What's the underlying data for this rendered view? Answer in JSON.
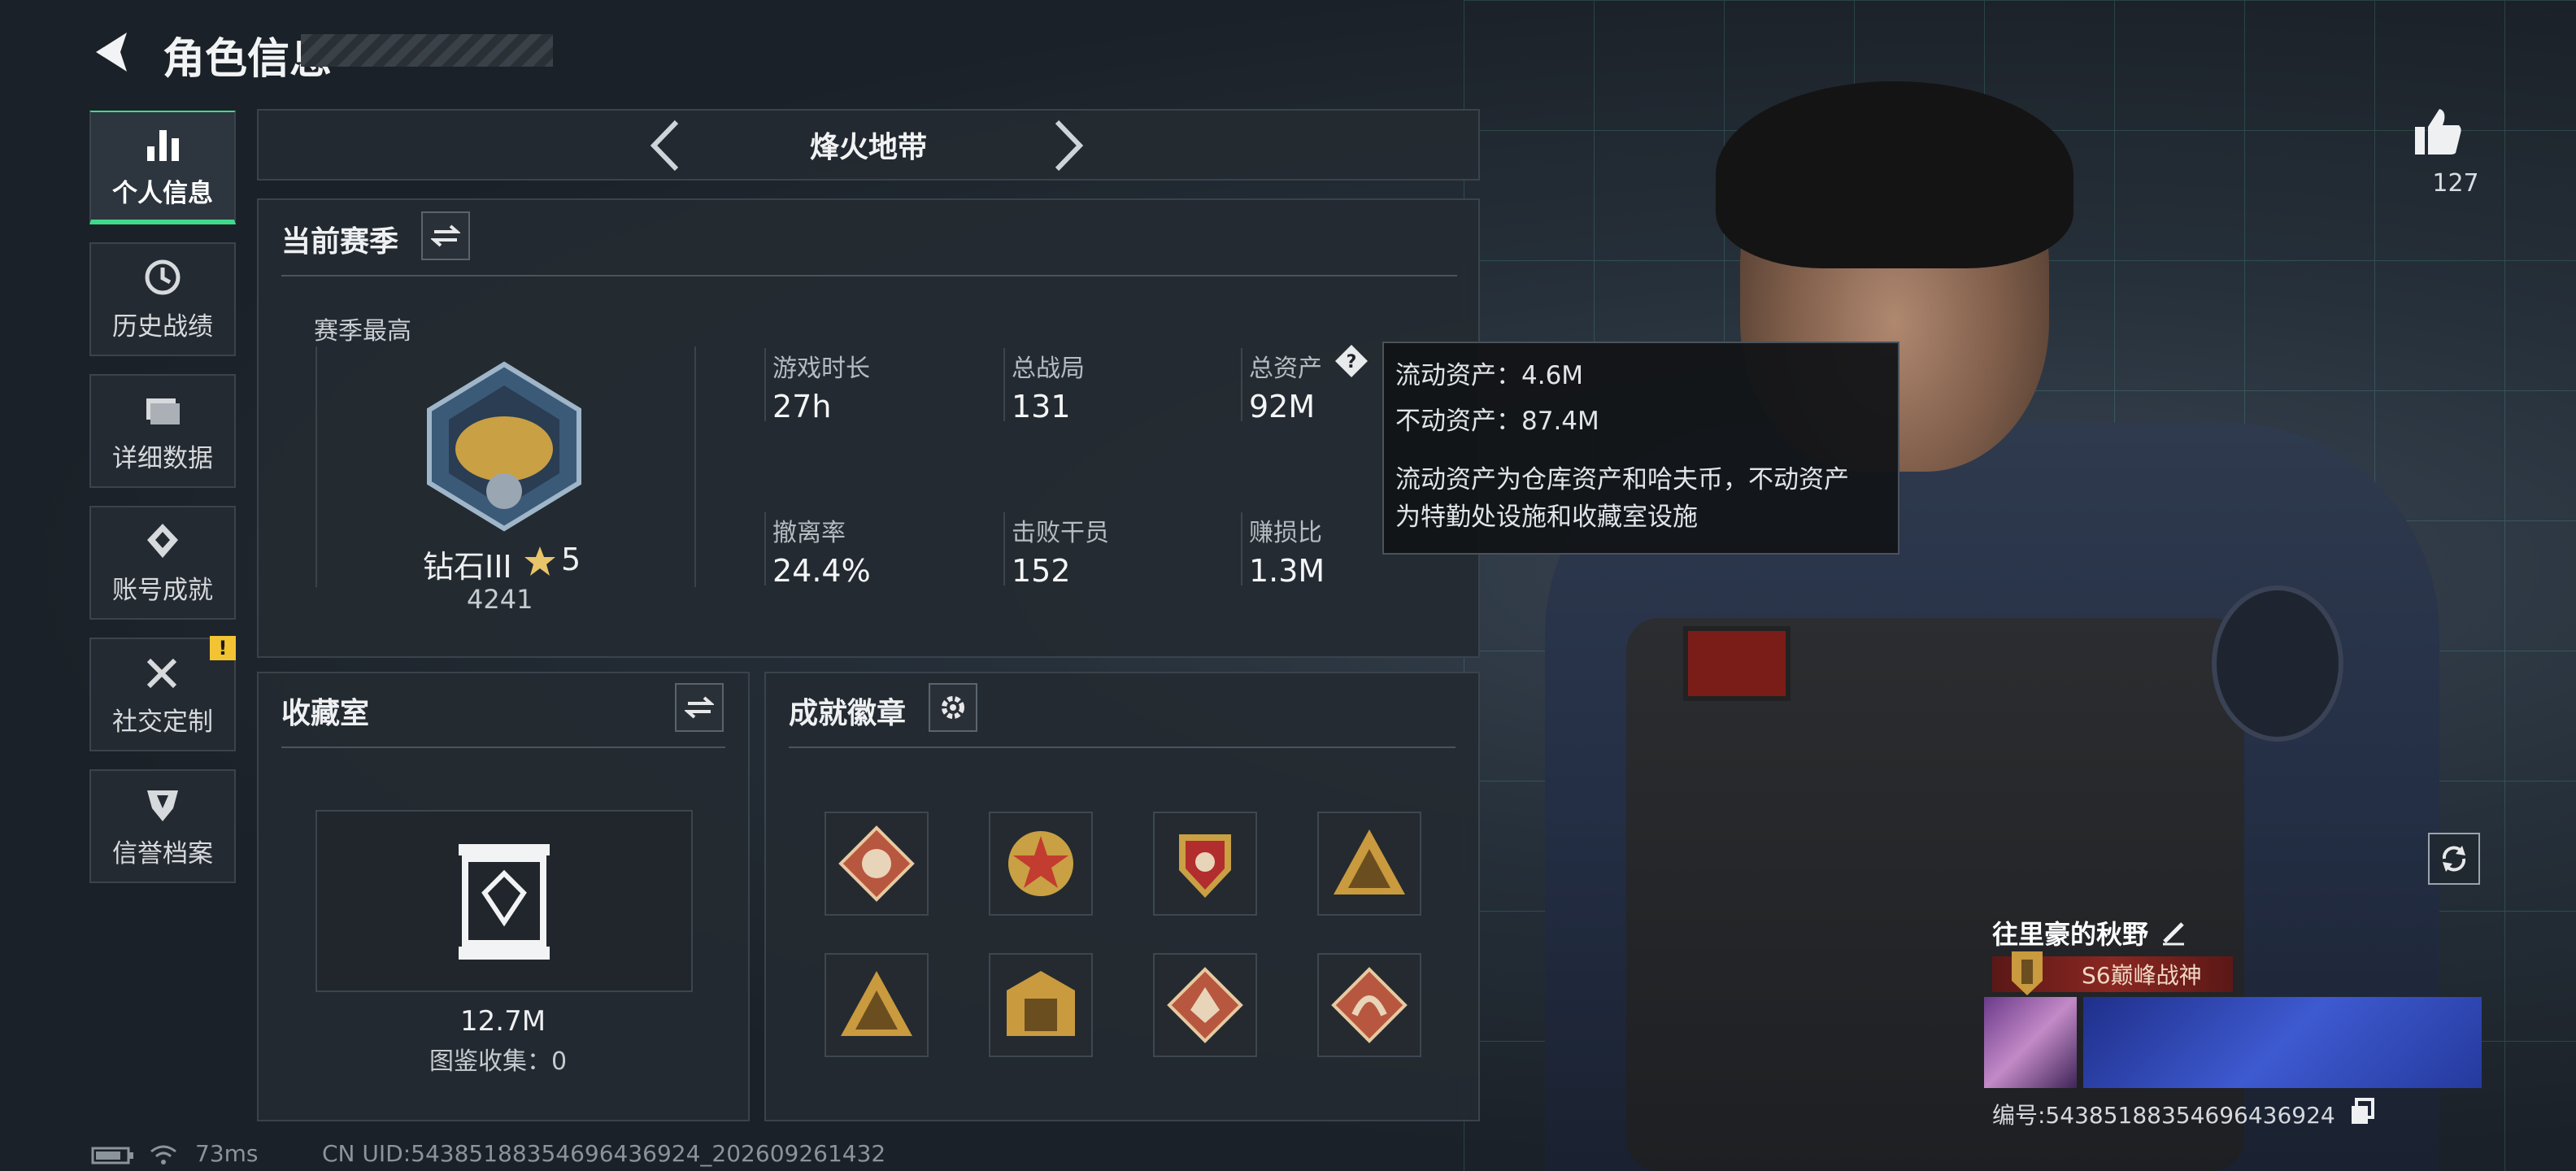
{
  "header": {
    "title": "角色信息"
  },
  "nav": {
    "items": [
      {
        "label": "个人信息",
        "icon": "bar-chart-icon",
        "active": true
      },
      {
        "label": "历史战绩",
        "icon": "history-clock-icon",
        "active": false
      },
      {
        "label": "详细数据",
        "icon": "folder-icon",
        "active": false
      },
      {
        "label": "账号成就",
        "icon": "achievement-badge-icon",
        "active": false
      },
      {
        "label": "社交定制",
        "icon": "tools-icon",
        "active": false
      },
      {
        "label": "信誉档案",
        "icon": "credit-shield-icon",
        "active": false
      }
    ],
    "warning_badge": "!"
  },
  "mode": {
    "name": "烽火地带"
  },
  "season": {
    "title": "当前赛季",
    "best_label": "赛季最高",
    "rank_name": "钻石III",
    "rank_stars": "5",
    "rank_score": "4241",
    "stats": [
      {
        "label": "游戏时长",
        "value": "27h"
      },
      {
        "label": "总战局",
        "value": "131"
      },
      {
        "label": "总资产",
        "value": "92M"
      },
      {
        "label": "撤离率",
        "value": "24.4%"
      },
      {
        "label": "击败干员",
        "value": "152"
      },
      {
        "label": "赚损比",
        "value": "1.3M"
      }
    ]
  },
  "tooltip": {
    "line1": "流动资产：4.6M",
    "line2": "不动资产：87.4M",
    "desc1": "流动资产为仓库资产和哈夫币，不动资产",
    "desc2": "为特勤处设施和收藏室设施"
  },
  "collection": {
    "title": "收藏室",
    "value": "12.7M",
    "catalog": "图鉴收集：0"
  },
  "achievements": {
    "title": "成就徽章",
    "badges": [
      {
        "icon": "beast-head-badge-icon",
        "color": "#b8573f"
      },
      {
        "icon": "star-emblem-badge-icon",
        "color": "#c23c2f"
      },
      {
        "icon": "shield-stars-badge-icon",
        "color": "#b22d2d"
      },
      {
        "icon": "s5-triangle-badge-icon",
        "color": "#c99a3e"
      },
      {
        "icon": "s6-triangle-badge-icon",
        "color": "#c99a3e"
      },
      {
        "icon": "gate-badge-icon",
        "color": "#c99a3e"
      },
      {
        "icon": "wolf-badge-icon",
        "color": "#b8573f"
      },
      {
        "icon": "dragon-badge-icon",
        "color": "#b8573f"
      }
    ]
  },
  "player": {
    "likes": "127",
    "name": "往里豪的秋野",
    "rank_title": "S6巅峰战神",
    "uid_display": "编号:543851883546964369​24"
  },
  "status": {
    "ping": "73ms",
    "uid_footer": "CN UID:543851883546964369​24_202609261432"
  },
  "colors": {
    "accent": "#3fd98c",
    "warning": "#f2c434",
    "rank_banner": "#8a2722"
  }
}
